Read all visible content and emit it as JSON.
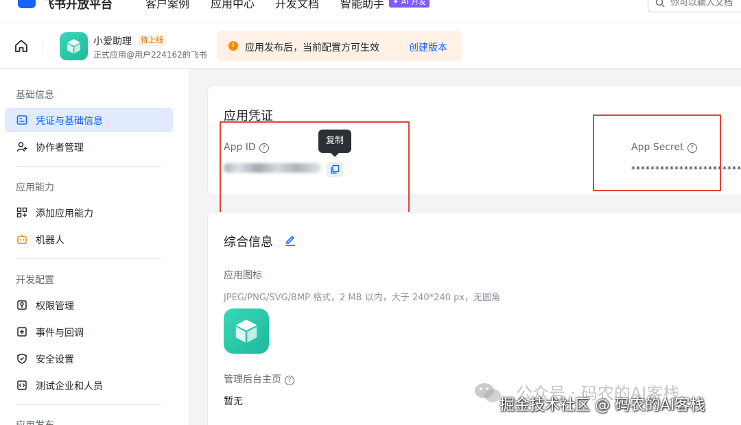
{
  "topbar": {
    "brand": "飞书开放平台",
    "nav": [
      "客户案例",
      "应用中心",
      "开发文档",
      "智能助手"
    ],
    "ai_badge": "✦ AI 开发",
    "search_placeholder": "你可以输入文档"
  },
  "app": {
    "name": "小爱助理",
    "status": "待上线",
    "subtitle": "正式应用@用户224162的飞书"
  },
  "notice": {
    "text": "应用发布后，当前配置方可生效",
    "link": "创建版本"
  },
  "sidebar": {
    "groups": [
      {
        "title": "基础信息",
        "items": [
          "凭证与基础信息",
          "协作者管理"
        ]
      },
      {
        "title": "应用能力",
        "items": [
          "添加应用能力",
          "机器人"
        ]
      },
      {
        "title": "开发配置",
        "items": [
          "权限管理",
          "事件与回调",
          "安全设置",
          "测试企业和人员"
        ]
      },
      {
        "title": "应用发布",
        "items": []
      }
    ]
  },
  "credentials": {
    "title": "应用凭证",
    "app_id_label": "App ID",
    "copy_tooltip": "复制",
    "app_secret_label": "App Secret",
    "app_secret_value": "****************************"
  },
  "info": {
    "title": "综合信息",
    "icon_label": "应用图标",
    "icon_format": "JPEG/PNG/SVG/BMP 格式，2 MB 以内，大于 240*240 px，无圆角",
    "admin_label": "管理后台主页",
    "admin_value": "暂无"
  },
  "watermark": {
    "line1": "公众号 · 码农的AI客栈",
    "line2": "掘金技术社区 @ 码农的AI客栈"
  },
  "colors": {
    "accent": "#1664ff",
    "annotation_red": "#e64232",
    "app_icon": "#1fb89c",
    "notice_bg": "#fff1e6"
  }
}
